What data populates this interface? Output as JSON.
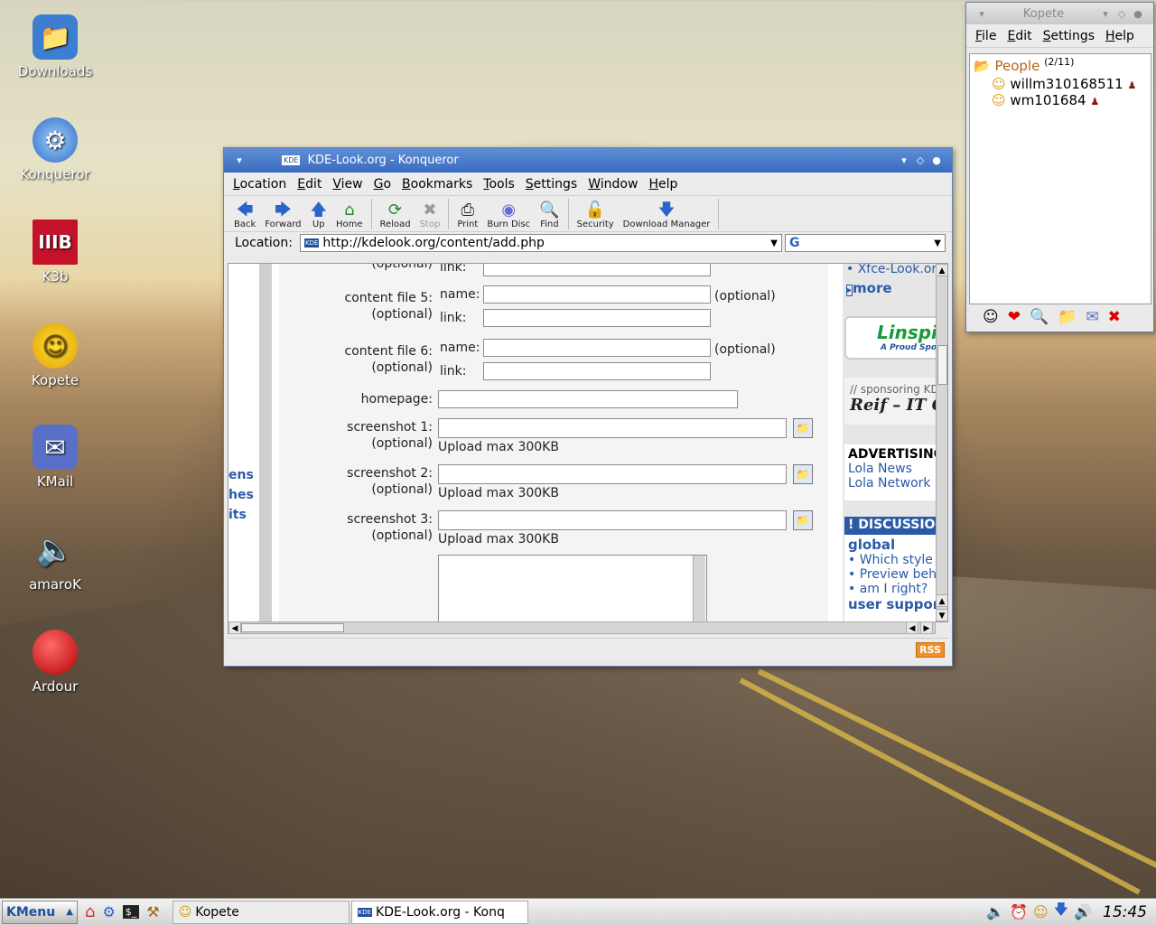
{
  "desktop": {
    "icons": [
      {
        "label": "Downloads",
        "icon": "folder-icon"
      },
      {
        "label": "Konqueror",
        "icon": "globe-icon"
      },
      {
        "label": "K3b",
        "icon": "k3b-icon"
      },
      {
        "label": "Kopete",
        "icon": "smiley-icon"
      },
      {
        "label": "KMail",
        "icon": "mail-icon"
      },
      {
        "label": "amaroK",
        "icon": "speaker-icon"
      },
      {
        "label": "Ardour",
        "icon": "record-icon"
      }
    ]
  },
  "kopete": {
    "title": "Kopete",
    "menu": [
      "File",
      "Edit",
      "Settings",
      "Help"
    ],
    "group": {
      "name": "People",
      "count": "(2/11)"
    },
    "contacts": [
      "willm310168511",
      "wm101684"
    ]
  },
  "konqueror": {
    "title": "KDE-Look.org  -  Konqueror",
    "menu": [
      "Location",
      "Edit",
      "View",
      "Go",
      "Bookmarks",
      "Tools",
      "Settings",
      "Window",
      "Help"
    ],
    "toolbar": [
      "Back",
      "Forward",
      "Up",
      "Home",
      "Reload",
      "Stop",
      "Print",
      "Burn Disc",
      "Find",
      "Security",
      "Download Manager"
    ],
    "location_label": "Location:",
    "url": "http://kdelook.org/content/add.php",
    "search_value": "",
    "form": {
      "partial_top": "(optional)",
      "link_label": "link:",
      "name_label": "name:",
      "optional": "(optional)",
      "content5": "content file 5:",
      "content6": "content file 6:",
      "homepage": "homepage:",
      "screenshot1": "screenshot 1:",
      "screenshot2": "screenshot 2:",
      "screenshot3": "screenshot 3:",
      "upload_max": "Upload max 300KB"
    },
    "left_fragments": [
      "ens",
      "hes",
      "its"
    ],
    "sidebar": {
      "xfce": "Xfce-Look.or",
      "more": "more",
      "linspire": "Linspi",
      "linspire_sub": "A Proud Spo",
      "sponsoring": "// sponsoring KD",
      "reif": "Reif – IT G",
      "advertising": "ADVERTISING",
      "lola_news": "Lola News",
      "lola_network": "Lola Network",
      "discussion": "! DISCUSSIO",
      "global": "global",
      "items": [
        "Which style",
        "Preview beh",
        "am I right?"
      ],
      "user_support": "user suppor"
    },
    "rss": "RSS"
  },
  "taskbar": {
    "kmenu": "KMenu",
    "tasks": [
      "Kopete",
      "KDE-Look.org - Konq"
    ],
    "clock": "15:45"
  }
}
